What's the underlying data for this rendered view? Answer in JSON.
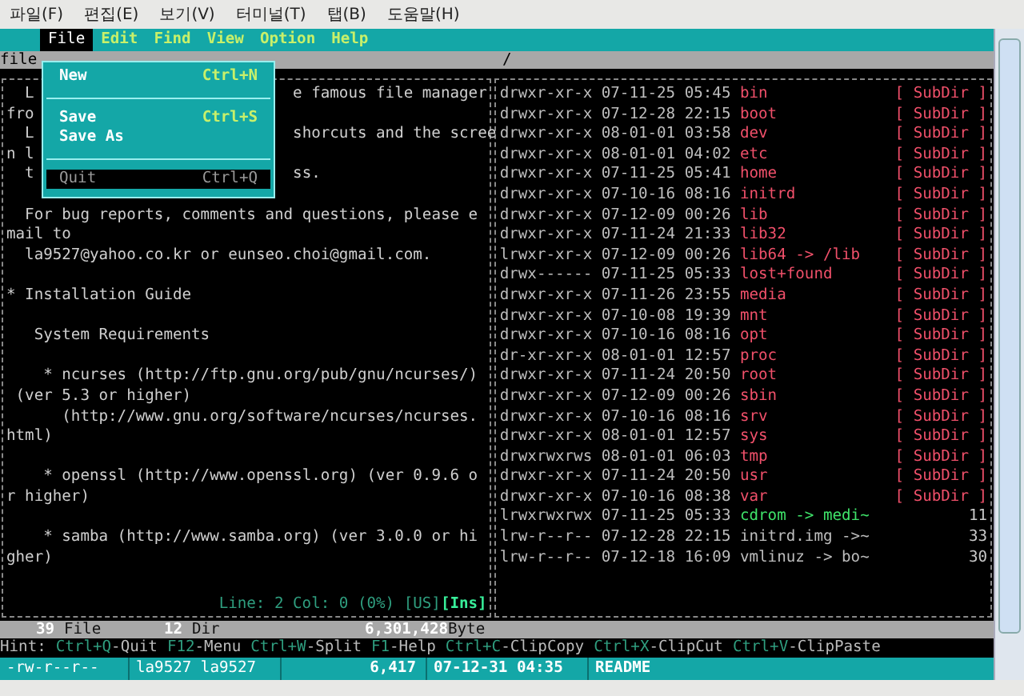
{
  "window_menu": [
    {
      "label": "파일(F)"
    },
    {
      "label": "편집(E)"
    },
    {
      "label": "보기(V)"
    },
    {
      "label": "터미널(T)"
    },
    {
      "label": "탭(B)"
    },
    {
      "label": "도움말(H)"
    }
  ],
  "menubar": [
    {
      "label": "File",
      "selected": true
    },
    {
      "label": "Edit",
      "selected": false
    },
    {
      "label": "Find",
      "selected": false
    },
    {
      "label": "View",
      "selected": false
    },
    {
      "label": "Option",
      "selected": false
    },
    {
      "label": "Help",
      "selected": false
    }
  ],
  "dropdown": {
    "groups": [
      [
        {
          "label": "New",
          "shortcut": "Ctrl+N",
          "selected": false
        }
      ],
      [
        {
          "label": "Save",
          "shortcut": "Ctrl+S",
          "selected": false
        },
        {
          "label": "Save As",
          "selected": false
        }
      ],
      [
        {
          "label": "Quit",
          "shortcut": "Ctrl+Q",
          "selected": true
        }
      ]
    ]
  },
  "path_bar": {
    "left": "file",
    "right": "/"
  },
  "editor_paragraphs": [
    [
      {
        "parts": [
          "  L",
          "e famous file manager"
        ]
      },
      {
        "parts": [
          "fro"
        ]
      },
      {
        "parts": [
          "  L",
          "shorcuts and the scree"
        ]
      },
      {
        "parts": [
          "n l"
        ]
      },
      {
        "parts": [
          "  t",
          "ss."
        ]
      }
    ],
    [
      {
        "parts": [
          "  For bug reports, comments and questions, please e"
        ]
      },
      {
        "parts": [
          "mail to"
        ]
      },
      {
        "parts": [
          "  la9527@yahoo.co.kr or eunseo.choi@gmail.com."
        ]
      }
    ],
    [
      {
        "parts": [
          "* Installation Guide"
        ]
      }
    ],
    [
      {
        "parts": [
          "   System Requirements"
        ]
      }
    ],
    [
      {
        "parts": [
          "    * ncurses (http://ftp.gnu.org/pub/gnu/ncurses/)"
        ]
      },
      {
        "parts": [
          " (ver 5.3 or higher)"
        ]
      },
      {
        "parts": [
          "      (http://www.gnu.org/software/ncurses/ncurses."
        ]
      },
      {
        "parts": [
          "html)"
        ]
      }
    ],
    [
      {
        "parts": [
          "    * openssl (http://www.openssl.org) (ver 0.9.6 o"
        ]
      },
      {
        "parts": [
          "r higher)"
        ]
      }
    ],
    [
      {
        "parts": [
          "    * samba (http://www.samba.org) (ver 3.0.0 or hi"
        ]
      },
      {
        "parts": [
          "gher)"
        ]
      }
    ]
  ],
  "editor_status": {
    "position": "Line: 2 Col: 0 (0%) [US]",
    "mode": "[Ins]"
  },
  "files": [
    {
      "perm": "drwxr-xr-x",
      "date": "07-11-25",
      "time": "05:45",
      "name": "bin",
      "kind": "dir",
      "info": "[ SubDir ]"
    },
    {
      "perm": "drwxr-xr-x",
      "date": "07-12-28",
      "time": "22:15",
      "name": "boot",
      "kind": "dir",
      "info": "[ SubDir ]"
    },
    {
      "perm": "drwxr-xr-x",
      "date": "08-01-01",
      "time": "03:58",
      "name": "dev",
      "kind": "dir",
      "info": "[ SubDir ]"
    },
    {
      "perm": "drwxr-xr-x",
      "date": "08-01-01",
      "time": "04:02",
      "name": "etc",
      "kind": "dir",
      "info": "[ SubDir ]"
    },
    {
      "perm": "drwxr-xr-x",
      "date": "07-11-25",
      "time": "05:41",
      "name": "home",
      "kind": "dir",
      "info": "[ SubDir ]"
    },
    {
      "perm": "drwxr-xr-x",
      "date": "07-10-16",
      "time": "08:16",
      "name": "initrd",
      "kind": "dir",
      "info": "[ SubDir ]"
    },
    {
      "perm": "drwxr-xr-x",
      "date": "07-12-09",
      "time": "00:26",
      "name": "lib",
      "kind": "dir",
      "info": "[ SubDir ]"
    },
    {
      "perm": "drwxr-xr-x",
      "date": "07-11-24",
      "time": "21:33",
      "name": "lib32",
      "kind": "dir",
      "info": "[ SubDir ]"
    },
    {
      "perm": "lrwxr-xr-x",
      "date": "07-12-09",
      "time": "00:26",
      "name": "lib64 -> /lib",
      "kind": "dir",
      "info": "[ SubDir ]"
    },
    {
      "perm": "drwx------",
      "date": "07-11-25",
      "time": "05:33",
      "name": "lost+found",
      "kind": "dir",
      "info": "[ SubDir ]"
    },
    {
      "perm": "drwxr-xr-x",
      "date": "07-11-26",
      "time": "23:55",
      "name": "media",
      "kind": "dir",
      "info": "[ SubDir ]"
    },
    {
      "perm": "drwxr-xr-x",
      "date": "07-10-08",
      "time": "19:39",
      "name": "mnt",
      "kind": "dir",
      "info": "[ SubDir ]"
    },
    {
      "perm": "drwxr-xr-x",
      "date": "07-10-16",
      "time": "08:16",
      "name": "opt",
      "kind": "dir",
      "info": "[ SubDir ]"
    },
    {
      "perm": "dr-xr-xr-x",
      "date": "08-01-01",
      "time": "12:57",
      "name": "proc",
      "kind": "dir",
      "info": "[ SubDir ]"
    },
    {
      "perm": "drwxr-xr-x",
      "date": "07-11-24",
      "time": "20:50",
      "name": "root",
      "kind": "dir",
      "info": "[ SubDir ]"
    },
    {
      "perm": "drwxr-xr-x",
      "date": "07-12-09",
      "time": "00:26",
      "name": "sbin",
      "kind": "dir",
      "info": "[ SubDir ]"
    },
    {
      "perm": "drwxr-xr-x",
      "date": "07-10-16",
      "time": "08:16",
      "name": "srv",
      "kind": "dir",
      "info": "[ SubDir ]"
    },
    {
      "perm": "drwxr-xr-x",
      "date": "08-01-01",
      "time": "12:57",
      "name": "sys",
      "kind": "dir",
      "info": "[ SubDir ]"
    },
    {
      "perm": "drwxrwxrws",
      "date": "08-01-01",
      "time": "06:03",
      "name": "tmp",
      "kind": "dir",
      "info": "[ SubDir ]"
    },
    {
      "perm": "drwxr-xr-x",
      "date": "07-11-24",
      "time": "20:50",
      "name": "usr",
      "kind": "dir",
      "info": "[ SubDir ]"
    },
    {
      "perm": "drwxr-xr-x",
      "date": "07-10-16",
      "time": "08:38",
      "name": "var",
      "kind": "dir",
      "info": "[ SubDir ]"
    },
    {
      "perm": "lrwxrwxrwx",
      "date": "07-11-25",
      "time": "05:33",
      "name": "cdrom -> medi~",
      "kind": "link",
      "info": "11"
    },
    {
      "perm": "lrw-r--r--",
      "date": "07-12-28",
      "time": "22:15",
      "name": "initrd.img ->~",
      "kind": "file",
      "info": "33"
    },
    {
      "perm": "lrw-r--r--",
      "date": "07-12-18",
      "time": "16:09",
      "name": "vmlinuz -> bo~",
      "kind": "file",
      "info": "30"
    }
  ],
  "summary": {
    "files": "39",
    "files_label": "File",
    "dirs": "12",
    "dirs_label": "Dir",
    "bytes": "6,301,428",
    "bytes_label": "Byte"
  },
  "hint": {
    "label": "Hint:",
    "items": [
      {
        "key": "Ctrl+Q",
        "action": "-Quit"
      },
      {
        "key": "F12",
        "action": "-Menu"
      },
      {
        "key": "Ctrl+W",
        "action": "-Split"
      },
      {
        "key": "F1",
        "action": "-Help"
      },
      {
        "key": "Ctrl+C",
        "action": "-ClipCopy"
      },
      {
        "key": "Ctrl+X",
        "action": "-ClipCut"
      },
      {
        "key": "Ctrl+V",
        "action": "-ClipPaste"
      }
    ]
  },
  "info_bar": {
    "perm": "-rw-r--r--",
    "owner": "la9527 la9527",
    "size": "6,417",
    "date": "07-12-31 04:35",
    "name": "README"
  }
}
